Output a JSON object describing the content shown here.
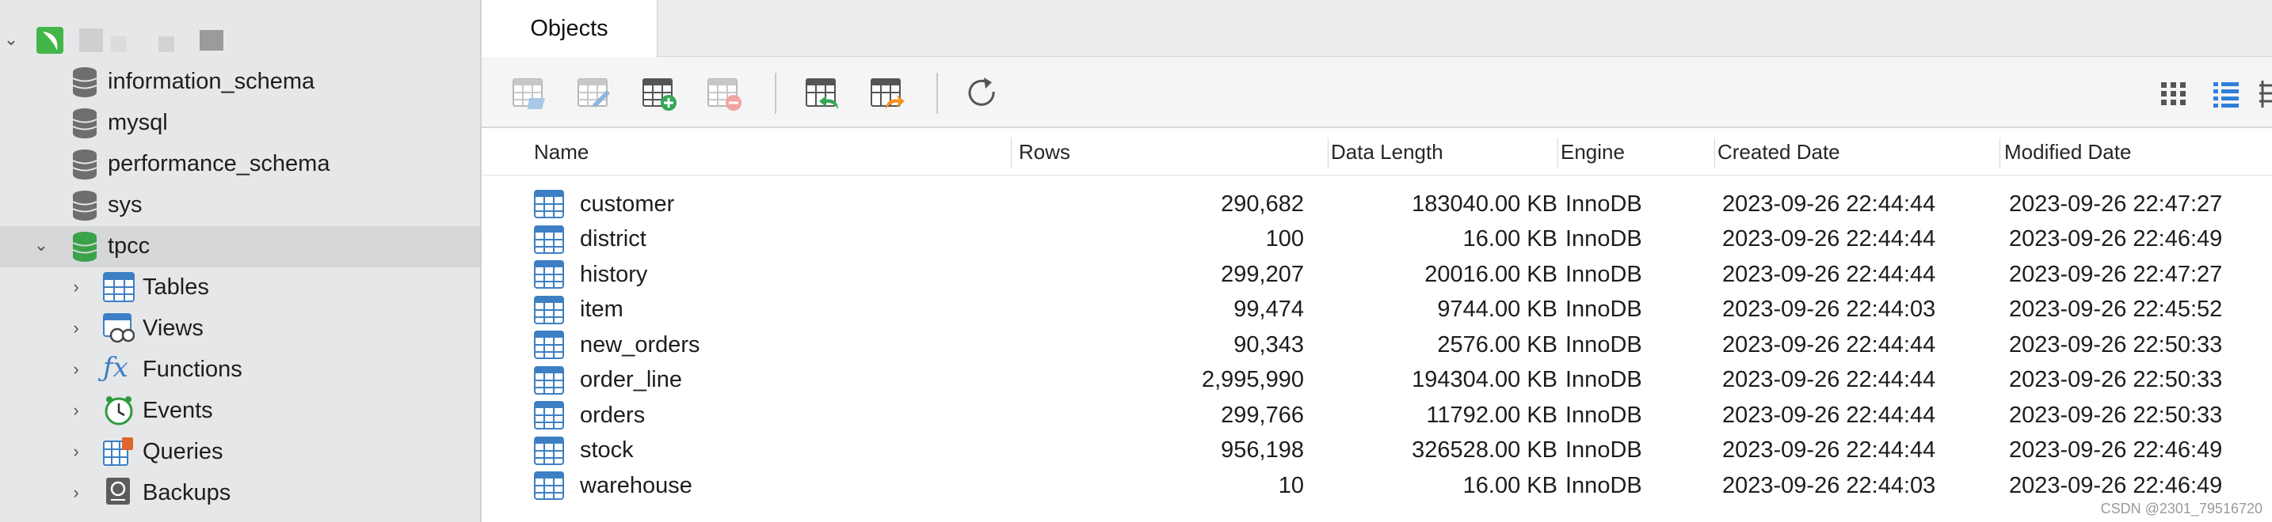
{
  "sidebar": {
    "connection": {
      "label": "",
      "icon": "connection-icon"
    },
    "databases": [
      {
        "label": "information_schema"
      },
      {
        "label": "mysql"
      },
      {
        "label": "performance_schema"
      },
      {
        "label": "sys"
      },
      {
        "label": "tpcc",
        "selected": true,
        "expanded": true
      }
    ],
    "tpcc_children": [
      {
        "label": "Tables",
        "icon": "table-icon"
      },
      {
        "label": "Views",
        "icon": "view-icon"
      },
      {
        "label": "Functions",
        "icon": "function-icon"
      },
      {
        "label": "Events",
        "icon": "clock-icon"
      },
      {
        "label": "Queries",
        "icon": "query-icon"
      },
      {
        "label": "Backups",
        "icon": "backup-icon"
      }
    ]
  },
  "tabs": [
    {
      "label": "Objects",
      "active": true
    }
  ],
  "toolbar": {
    "buttons": [
      "open-table-icon",
      "design-table-icon",
      "new-table-icon",
      "delete-table-icon",
      "import-icon",
      "export-icon",
      "refresh-icon"
    ],
    "view_buttons": [
      "grid-view-icon",
      "list-view-icon",
      "detail-view-icon"
    ]
  },
  "columns": [
    "Name",
    "Rows",
    "Data Length",
    "Engine",
    "Created Date",
    "Modified Date"
  ],
  "rows": [
    {
      "name": "customer",
      "rows": "290,682",
      "data_length": "183040.00 KB",
      "engine": "InnoDB",
      "created": "2023-09-26 22:44:44",
      "modified": "2023-09-26 22:47:27"
    },
    {
      "name": "district",
      "rows": "100",
      "data_length": "16.00 KB",
      "engine": "InnoDB",
      "created": "2023-09-26 22:44:44",
      "modified": "2023-09-26 22:46:49"
    },
    {
      "name": "history",
      "rows": "299,207",
      "data_length": "20016.00 KB",
      "engine": "InnoDB",
      "created": "2023-09-26 22:44:44",
      "modified": "2023-09-26 22:47:27"
    },
    {
      "name": "item",
      "rows": "99,474",
      "data_length": "9744.00 KB",
      "engine": "InnoDB",
      "created": "2023-09-26 22:44:03",
      "modified": "2023-09-26 22:45:52"
    },
    {
      "name": "new_orders",
      "rows": "90,343",
      "data_length": "2576.00 KB",
      "engine": "InnoDB",
      "created": "2023-09-26 22:44:44",
      "modified": "2023-09-26 22:50:33"
    },
    {
      "name": "order_line",
      "rows": "2,995,990",
      "data_length": "194304.00 KB",
      "engine": "InnoDB",
      "created": "2023-09-26 22:44:44",
      "modified": "2023-09-26 22:50:33"
    },
    {
      "name": "orders",
      "rows": "299,766",
      "data_length": "11792.00 KB",
      "engine": "InnoDB",
      "created": "2023-09-26 22:44:44",
      "modified": "2023-09-26 22:50:33"
    },
    {
      "name": "stock",
      "rows": "956,198",
      "data_length": "326528.00 KB",
      "engine": "InnoDB",
      "created": "2023-09-26 22:44:44",
      "modified": "2023-09-26 22:46:49"
    },
    {
      "name": "warehouse",
      "rows": "10",
      "data_length": "16.00 KB",
      "engine": "InnoDB",
      "created": "2023-09-26 22:44:03",
      "modified": "2023-09-26 22:46:49"
    }
  ],
  "watermark": "CSDN @2301_79516720",
  "colors": {
    "sidebar_bg": "#e6e7e8",
    "selected_row": "#d6d7d9",
    "db_green": "#3aa34a",
    "db_gray": "#6e6e6e",
    "table_blue": "#3d7fc4"
  }
}
